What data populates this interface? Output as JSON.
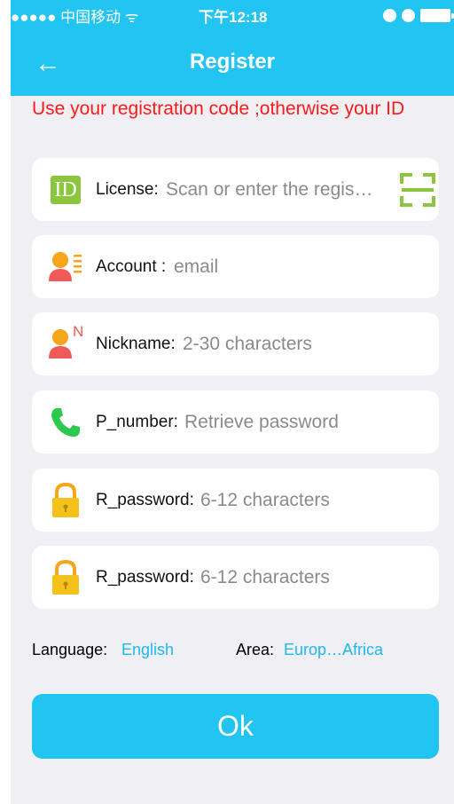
{
  "status_bar": {
    "carrier": "●●●●● 中国移动",
    "wifi_glyph": "ᯤ",
    "time": "下午12:18"
  },
  "nav": {
    "back_glyph": "←",
    "title": "Register"
  },
  "notice": "Use your registration code ;otherwise your ID",
  "form": {
    "license": {
      "label": "License:",
      "placeholder": "Scan or enter the regis…",
      "icon_text": "ID"
    },
    "account": {
      "label": "Account :",
      "placeholder": "email"
    },
    "nickname": {
      "label": "Nickname:",
      "placeholder": "2-30 characters",
      "icon_badge": "N"
    },
    "phone": {
      "label": "P_number:",
      "placeholder": "Retrieve password"
    },
    "password": {
      "label": "R_password:",
      "placeholder": "6-12 characters"
    },
    "password_confirm": {
      "label": "R_password:",
      "placeholder": "6-12 characters"
    }
  },
  "settings": {
    "language_label": "Language:",
    "language_value": "English",
    "area_label": "Area:",
    "area_value": "Europ…Africa"
  },
  "ok_label": "Ok",
  "colors": {
    "accent": "#22c4f1",
    "notice_red": "#ff1a1a",
    "green": "#8cc63f",
    "avatar_orange": "#f7a51c",
    "avatar_red": "#f05a5a",
    "lock_yellow": "#f5c21b",
    "phone_green": "#2dc94c"
  }
}
